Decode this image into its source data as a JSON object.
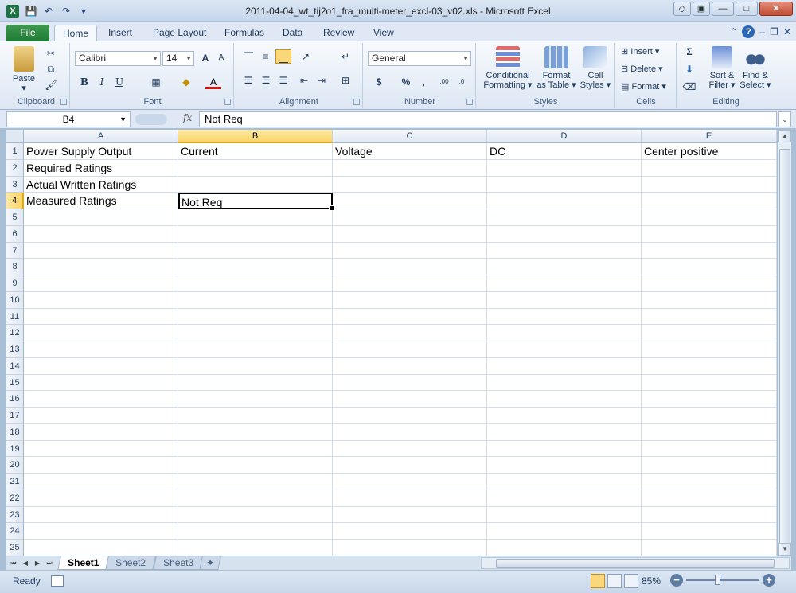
{
  "window": {
    "title": "2011-04-04_wt_tij2o1_fra_multi-meter_excl-03_v02.xls  -  Microsoft Excel",
    "app_icon": "X"
  },
  "ribbon_tabs": [
    "File",
    "Home",
    "Insert",
    "Page Layout",
    "Formulas",
    "Data",
    "Review",
    "View"
  ],
  "active_tab": "Home",
  "clipboard": {
    "paste_label": "Paste",
    "group_label": "Clipboard"
  },
  "font": {
    "name": "Calibri",
    "size": "14",
    "bold": "B",
    "italic": "I",
    "underline": "U",
    "grow": "A",
    "shrink": "A",
    "color_letter": "A",
    "group_label": "Font"
  },
  "alignment": {
    "group_label": "Alignment"
  },
  "number": {
    "format": "General",
    "currency": "$",
    "percent": "%",
    "comma": ",",
    "inc_decimal": "←.0 .00",
    "dec_decimal": ".00 →.0",
    "group_label": "Number"
  },
  "styles": {
    "conditional": "Conditional Formatting",
    "conditional_l1": "Conditional",
    "conditional_l2": "Formatting",
    "format_table_l1": "Format",
    "format_table_l2": "as Table",
    "cell_styles_l1": "Cell",
    "cell_styles_l2": "Styles",
    "group_label": "Styles"
  },
  "cells": {
    "insert": "Insert",
    "delete": "Delete",
    "format": "Format",
    "group_label": "Cells"
  },
  "editing": {
    "sigma": "Σ",
    "sort_l1": "Sort &",
    "sort_l2": "Filter",
    "find_l1": "Find &",
    "find_l2": "Select",
    "group_label": "Editing"
  },
  "formula_bar": {
    "name_box": "B4",
    "fx": "fx",
    "content": "Not Req"
  },
  "columns": [
    "A",
    "B",
    "C",
    "D",
    "E"
  ],
  "selected_column": "B",
  "selected_row": 4,
  "rows": [
    [
      "Power Supply Output",
      "Current",
      "Voltage",
      "DC",
      "Center positive"
    ],
    [
      "Required Ratings",
      "",
      "",
      "",
      ""
    ],
    [
      "Actual Written Ratings",
      "",
      "",
      "",
      ""
    ],
    [
      "Measured Ratings",
      "Not Req",
      "",
      "",
      ""
    ]
  ],
  "row_count": 25,
  "sheets": [
    "Sheet1",
    "Sheet2",
    "Sheet3"
  ],
  "active_sheet": "Sheet1",
  "status": {
    "mode": "Ready",
    "zoom": "85%"
  }
}
